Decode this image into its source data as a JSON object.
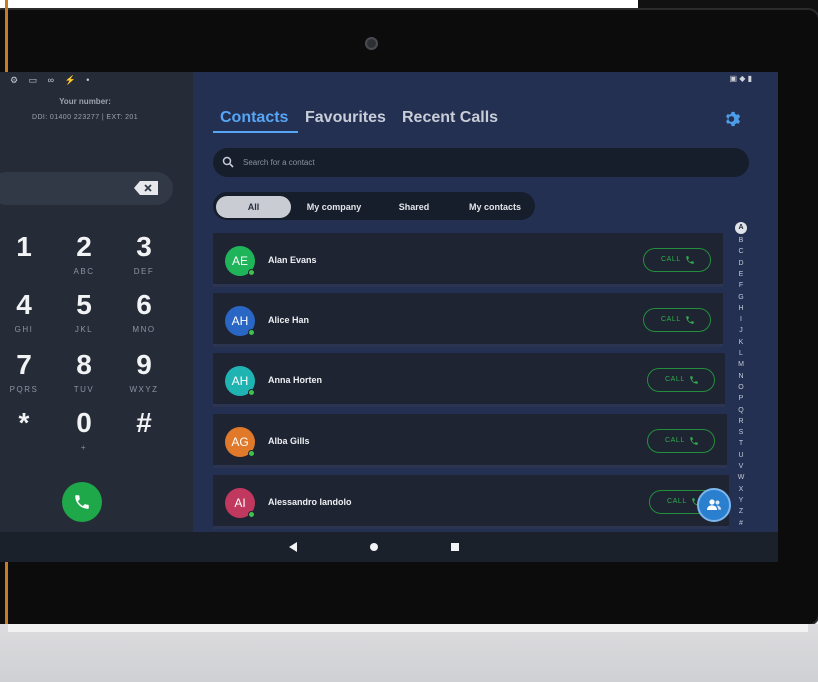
{
  "status_bar": {
    "left_icons": "⚙ ▭ ∞ ⚡ •",
    "right_icons": "▣ ◆ ▮"
  },
  "dialer": {
    "your_number_label": "Your number:",
    "ddi_line": "DDI: 01400 223277  |  EXT: 201",
    "keys": [
      {
        "digit": "1",
        "letters": ""
      },
      {
        "digit": "2",
        "letters": "ABC"
      },
      {
        "digit": "3",
        "letters": "DEF"
      },
      {
        "digit": "4",
        "letters": "GHI"
      },
      {
        "digit": "5",
        "letters": "JKL"
      },
      {
        "digit": "6",
        "letters": "MNO"
      },
      {
        "digit": "7",
        "letters": "PQRS"
      },
      {
        "digit": "8",
        "letters": "TUV"
      },
      {
        "digit": "9",
        "letters": "WXYZ"
      },
      {
        "digit": "*",
        "letters": ""
      },
      {
        "digit": "0",
        "letters": "+"
      },
      {
        "digit": "#",
        "letters": ""
      }
    ]
  },
  "tabs": [
    "Contacts",
    "Favourites",
    "Recent Calls"
  ],
  "search": {
    "placeholder": "Search for a contact"
  },
  "filters": [
    "All",
    "My company",
    "Shared",
    "My contacts"
  ],
  "contacts": [
    {
      "initials": "AE",
      "name": "Alan Evans",
      "color": "#20b45a",
      "call": "CALL"
    },
    {
      "initials": "AH",
      "name": "Alice Han",
      "color": "#2a66c3",
      "call": "CALL"
    },
    {
      "initials": "AH",
      "name": "Anna Horten",
      "color": "#1fb3b1",
      "call": "CALL"
    },
    {
      "initials": "AG",
      "name": "Alba Gills",
      "color": "#e07a2a",
      "call": "CALL"
    },
    {
      "initials": "AI",
      "name": "Alessandro Iandolo",
      "color": "#c0385d",
      "call": "CALL"
    }
  ],
  "alphabet": [
    "A",
    "B",
    "C",
    "D",
    "E",
    "F",
    "G",
    "H",
    "I",
    "J",
    "K",
    "L",
    "M",
    "N",
    "O",
    "P",
    "Q",
    "R",
    "S",
    "T",
    "U",
    "V",
    "W",
    "X",
    "Y",
    "Z",
    "#"
  ],
  "colors": {
    "accent": "#56a6f5",
    "call_green": "#1fa84a",
    "panel_bg": "#243052"
  }
}
